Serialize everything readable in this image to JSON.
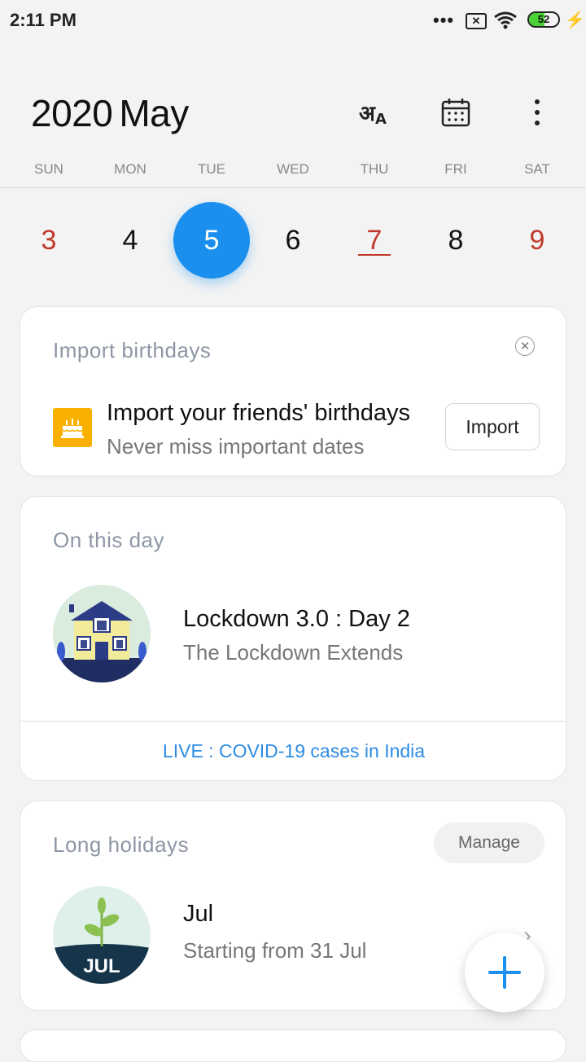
{
  "status_bar": {
    "time": "2:11 PM",
    "dots": "•••",
    "battery": "52",
    "battery_level": 0.52
  },
  "header": {
    "year": "2020",
    "month": "May",
    "icons": [
      "language-icon",
      "calendar-icon",
      "more-icon"
    ]
  },
  "weekdays": [
    "SUN",
    "MON",
    "TUE",
    "WED",
    "THU",
    "FRI",
    "SAT"
  ],
  "days": [
    "3",
    "4",
    "5",
    "6",
    "7",
    "8",
    "9"
  ],
  "selected_day": "5",
  "import_card": {
    "title": "Import birthdays",
    "main": "Import your friends' birthdays",
    "sub": "Never miss important dates",
    "button": "Import"
  },
  "on_this_day": {
    "title": "On this day",
    "main": "Lockdown 3.0 : Day 2",
    "sub": "The Lockdown Extends",
    "link": "LIVE : COVID-19 cases in India"
  },
  "holidays": {
    "title": "Long holidays",
    "manage": "Manage",
    "badge": "JUL",
    "main": "Jul",
    "sub": "Starting from 31 Jul"
  },
  "colors": {
    "accent": "#1a8fee",
    "weekend": "#c0392b",
    "link": "#2d8ce3",
    "cake_bg": "#f9b000"
  }
}
